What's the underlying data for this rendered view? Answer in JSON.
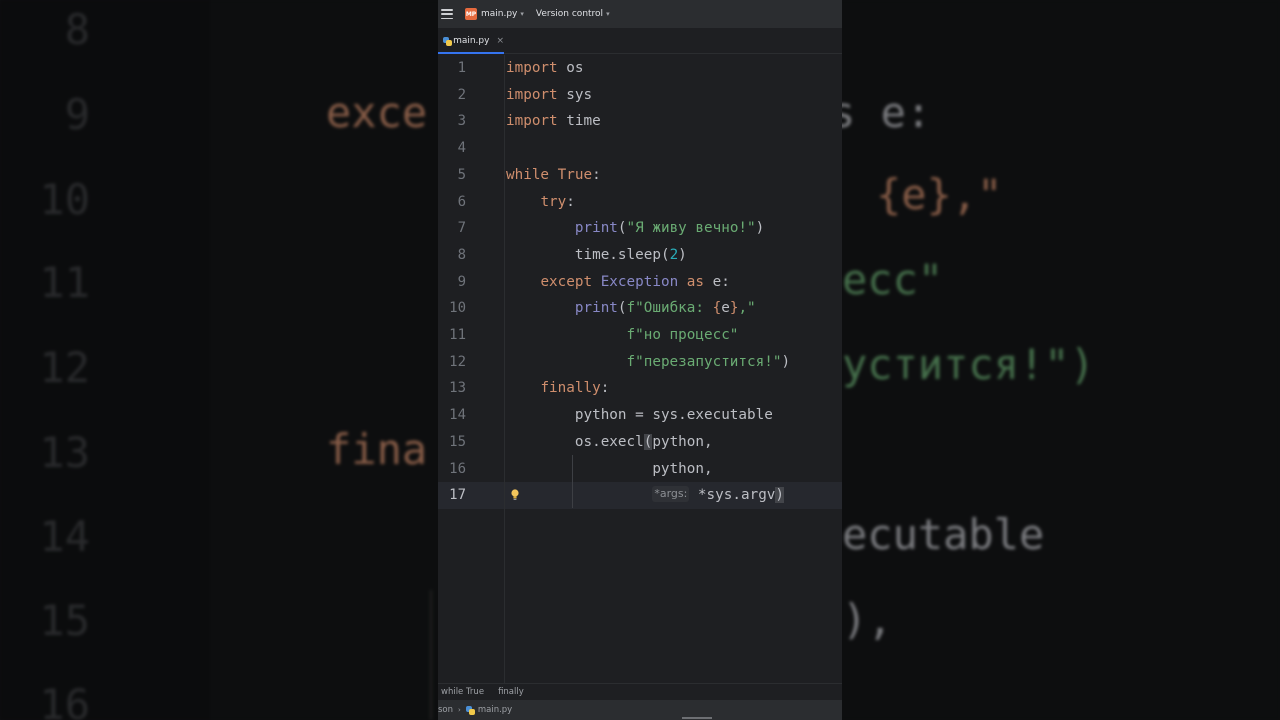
{
  "titlebar": {
    "project_badge": "MP",
    "project_name": "main.py",
    "vcs_label": "Version control"
  },
  "tab": {
    "label": "main.py",
    "close": "×"
  },
  "line_numbers": [
    "1",
    "2",
    "3",
    "4",
    "5",
    "6",
    "7",
    "8",
    "9",
    "10",
    "11",
    "12",
    "13",
    "14",
    "15",
    "16",
    "17"
  ],
  "code": {
    "l1": {
      "kw": "import",
      "rest": " os"
    },
    "l2": {
      "kw": "import",
      "rest": " sys"
    },
    "l3": {
      "kw": "import",
      "rest": " time"
    },
    "l5": {
      "kw_while": "while",
      "kw_true": "True",
      "colon": ":"
    },
    "l6": {
      "indent": "    ",
      "kw": "try",
      "colon": ":"
    },
    "l7": {
      "indent": "        ",
      "fn": "print",
      "open": "(",
      "str": "\"Я живу вечно!\"",
      "close": ")"
    },
    "l8": {
      "indent": "        ",
      "text": "time.sleep(",
      "num": "2",
      "close": ")"
    },
    "l9": {
      "indent": "    ",
      "kw_except": "except",
      "exc": "Exception",
      "kw_as": "as",
      "rest": " e:"
    },
    "l10": {
      "indent": "        ",
      "fn": "print",
      "open": "(",
      "f": "f\"Ошибка: ",
      "brace_open": "{",
      "var": "e",
      "brace_close": "}",
      "str_end": ",\""
    },
    "l11": {
      "indent": "              ",
      "str": "f\"но процесс\""
    },
    "l12": {
      "indent": "              ",
      "str": "f\"перезапустится!\"",
      "close": ")"
    },
    "l13": {
      "indent": "    ",
      "kw": "finally",
      "colon": ":"
    },
    "l14": {
      "indent": "        ",
      "text": "python = sys.executable"
    },
    "l15": {
      "indent": "        ",
      "text": "os.execl",
      "paren": "(",
      "rest": "python,"
    },
    "l16": {
      "indent": "                 ",
      "text": "python,"
    },
    "l17": {
      "indent": "                 ",
      "hint": "*args:",
      "rest": " *sys.argv",
      "paren": ")"
    }
  },
  "breadcrumbs": {
    "first": "while True",
    "second": "finally"
  },
  "statusbar": {
    "project": "son",
    "sep": "›",
    "file": "main.py"
  },
  "background": {
    "numbers": [
      "8",
      "9",
      "10",
      "11",
      "12",
      "13",
      "14",
      "15",
      "16"
    ],
    "l9_left": "exce",
    "l9_right": "s e:",
    "l10_right": "{e},\"",
    "l11_right": "есс\"",
    "l12_right": "устится!\")",
    "l13_left": "fina",
    "l14_right": "ecutable",
    "l15_right": "),"
  },
  "colors": {
    "keyword": "#cf8e6d",
    "builtin": "#8888c6",
    "string": "#6aab73",
    "number": "#2aacb8",
    "text": "#bcbec4",
    "accent": "#3574f0"
  }
}
